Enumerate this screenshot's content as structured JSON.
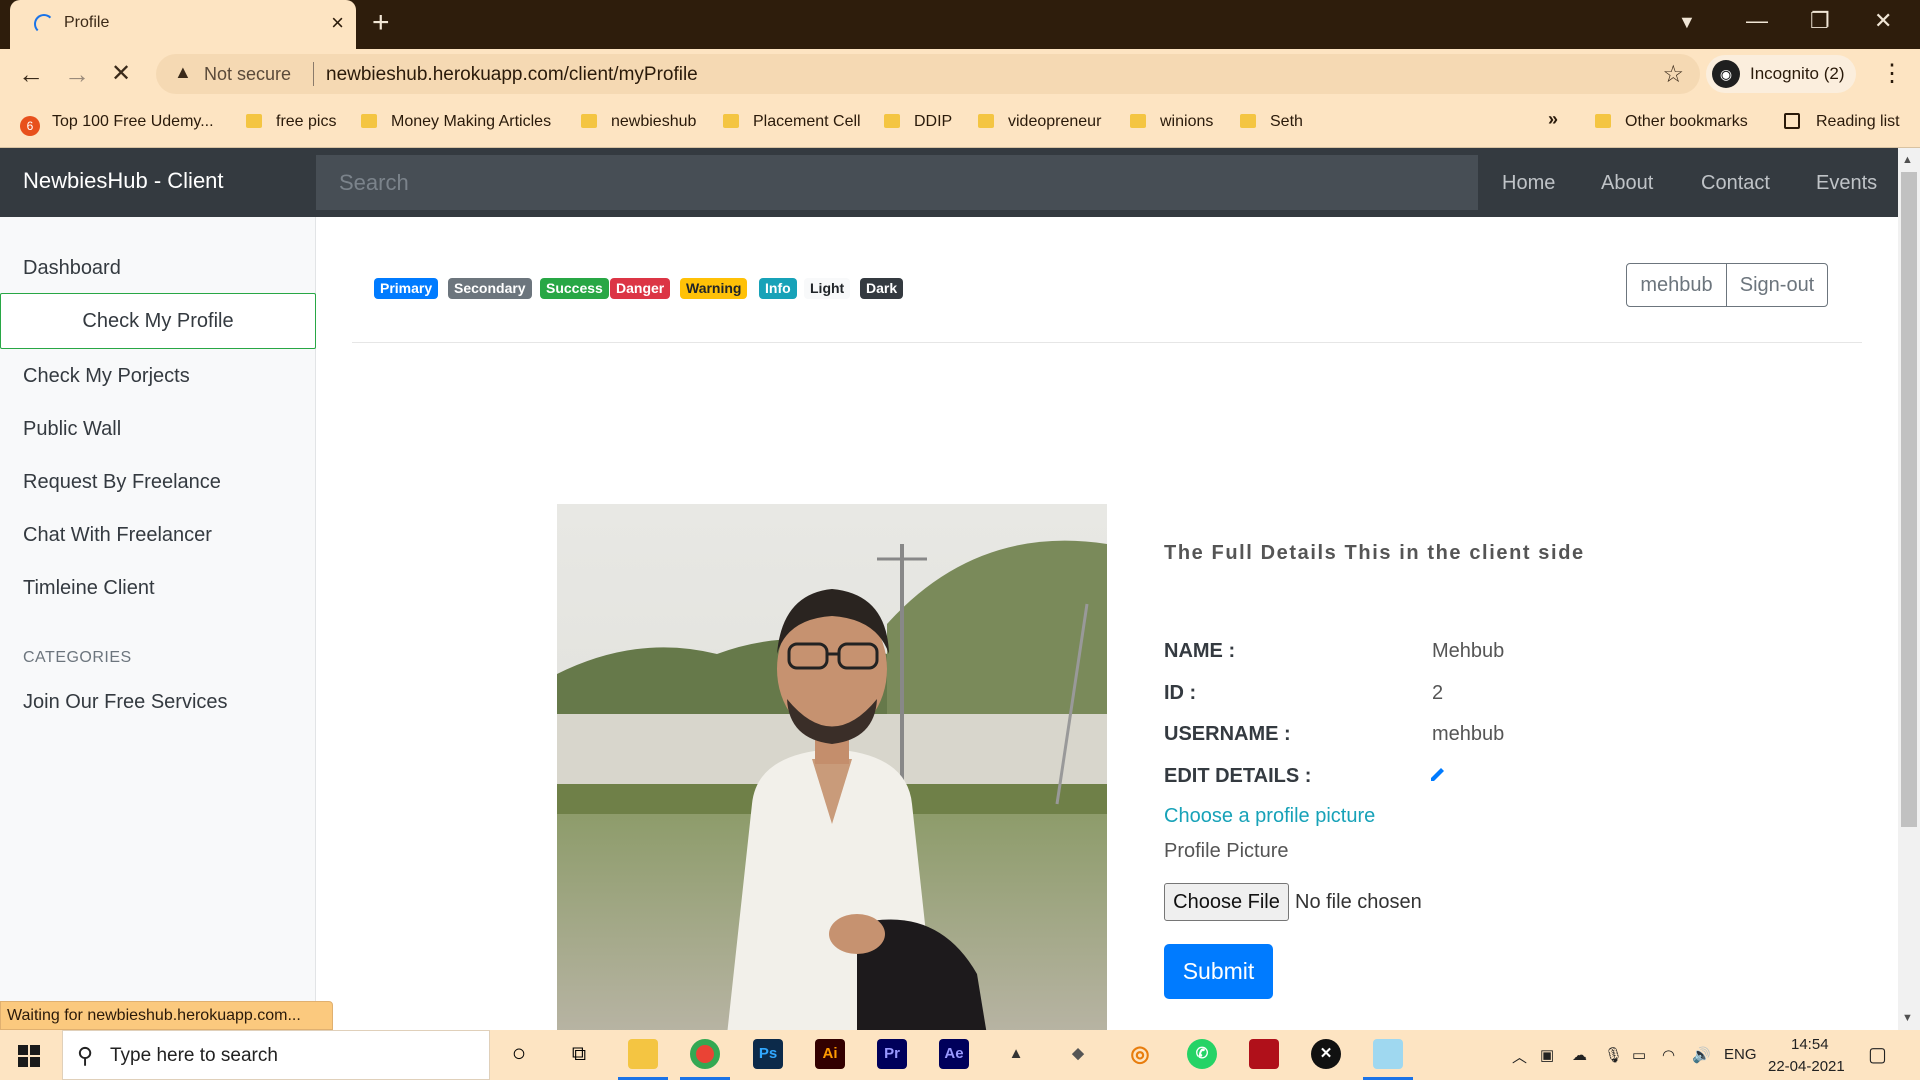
{
  "browser": {
    "tab_title": "Profile",
    "address_warning": "Not secure",
    "url": "newbieshub.herokuapp.com/client/myProfile",
    "incognito_label": "Incognito (2)",
    "bookmarks": [
      "Top 100 Free Udemy...",
      "free pics",
      "Money Making Articles",
      "newbieshub",
      "Placement Cell",
      "DDIP",
      "videopreneur",
      "winions",
      "Seth"
    ],
    "overflow": "»",
    "other_bookmarks": "Other bookmarks",
    "reading_list": "Reading list",
    "status_text": "Waiting for newbieshub.herokuapp.com..."
  },
  "site": {
    "brand": "NewbiesHub - Client",
    "search_placeholder": "Search",
    "nav": [
      "Home",
      "About",
      "Contact",
      "Events"
    ]
  },
  "sidebar": {
    "items": [
      "Dashboard",
      "Check My Profile",
      "Check My Porjects",
      "Public Wall",
      "Request By Freelance",
      "Chat With Freelancer",
      "Timleine Client"
    ],
    "active_index": 1,
    "categories_heading": "CATEGORIES",
    "category_items": [
      "Join Our Free Services"
    ]
  },
  "badges": [
    {
      "label": "Primary",
      "color": "#007bff"
    },
    {
      "label": "Secondary",
      "color": "#6c757d"
    },
    {
      "label": "Success",
      "color": "#28a745"
    },
    {
      "label": "Danger",
      "color": "#dc3545"
    },
    {
      "label": "Warning",
      "color": "#ffc107"
    },
    {
      "label": "Info",
      "color": "#17a2b8"
    },
    {
      "label": "Light",
      "color": "#f8f9fa"
    },
    {
      "label": "Dark",
      "color": "#343a40"
    }
  ],
  "account": {
    "username_button": "mehbub",
    "signout_button": "Sign-out"
  },
  "profile": {
    "heading": "The Full Details This in the client side",
    "name_label": "NAME :",
    "name_value": "Mehbub",
    "id_label": "ID :",
    "id_value": "2",
    "username_label": "USERNAME :",
    "username_value": "mehbub",
    "edit_label": "EDIT DETAILS :",
    "choose_link": "Choose a profile picture",
    "picture_label": "Profile Picture",
    "file_button": "Choose File",
    "file_status": "No file chosen",
    "submit_label": "Submit"
  },
  "taskbar": {
    "search_placeholder": "Type here to search",
    "language": "ENG",
    "time": "14:54",
    "date": "22-04-2021"
  }
}
